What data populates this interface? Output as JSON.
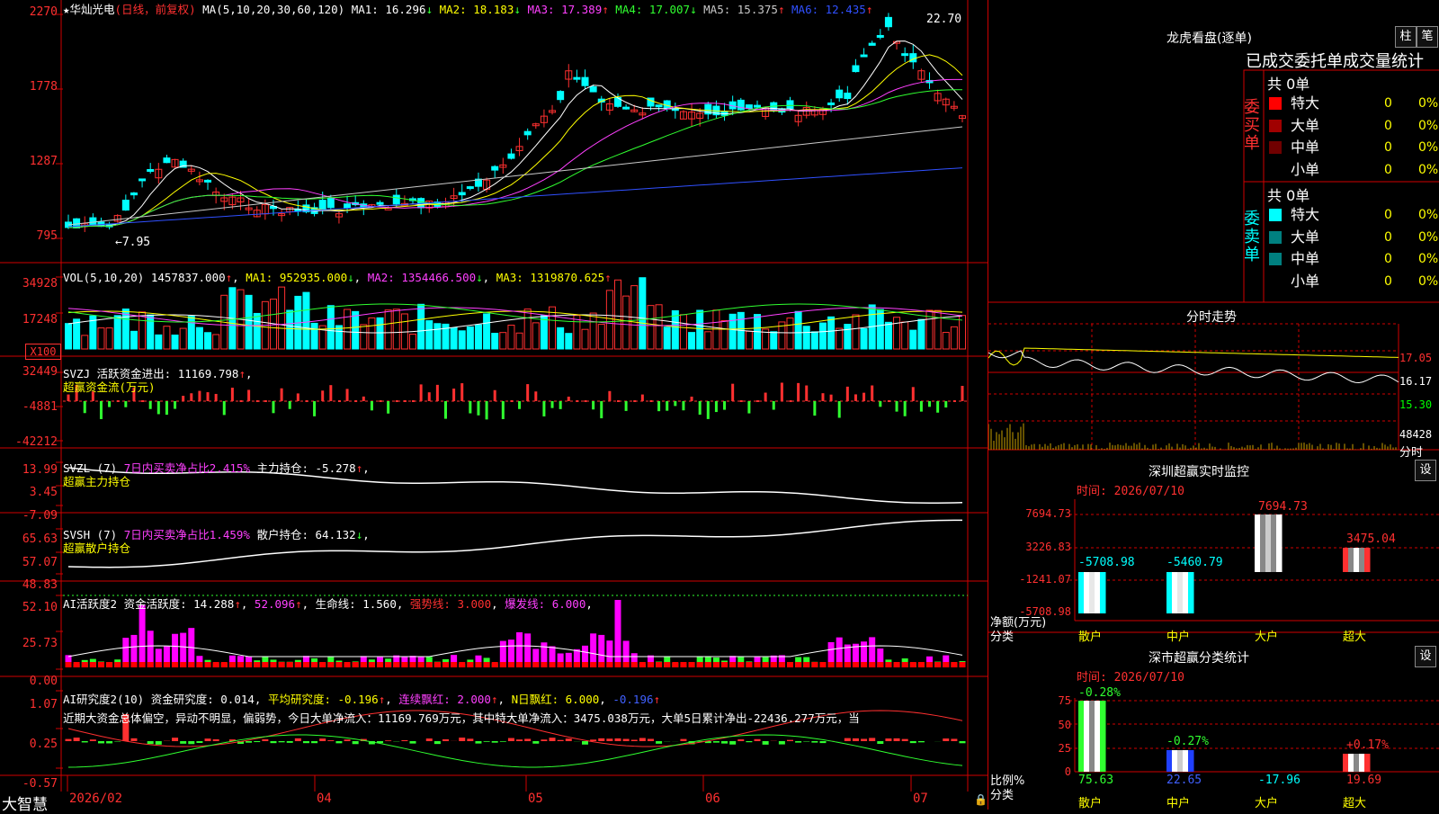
{
  "stock": {
    "name": "华灿光电",
    "mode": "(日线，前复权)",
    "ma_params": "MA(5,10,20,30,60,120)",
    "ma_values": [
      {
        "label": "MA1: 16.296",
        "arrow": "↓",
        "color": "#ffffff"
      },
      {
        "label": "MA2: 18.183",
        "arrow": "↓",
        "color": "#ffff00"
      },
      {
        "label": "MA3: 17.389",
        "arrow": "↑",
        "color": "#ff40ff"
      },
      {
        "label": "MA4: 17.007",
        "arrow": "↓",
        "color": "#30ff30"
      },
      {
        "label": "MA5: 15.375",
        "arrow": "↑",
        "color": "#c8c8c8"
      },
      {
        "label": "MA6: 12.435",
        "arrow": "↑",
        "color": "#3050ff"
      }
    ],
    "high_marker": "22.70",
    "low_marker": "7.95",
    "price_ticks": [
      "2270",
      "1778",
      "1287",
      "795"
    ]
  },
  "volume": {
    "title": "VOL(5,10,20)",
    "value": "1457837.000",
    "ma1": "MA1: 952935.000",
    "ma2": "MA2: 1354466.500",
    "ma3": "MA3: 1319870.625",
    "ticks": [
      "34928",
      "17248"
    ],
    "unit": "X100"
  },
  "svzj": {
    "title": "SVZJ",
    "label": "活跃资金进出: 11169.798",
    "subtitle": "超赢资金流(万元)",
    "ticks": [
      "32449",
      "-4881",
      "-42212"
    ]
  },
  "svzl": {
    "title": "SVZL (7)",
    "label1": "7日内买卖净占比2.415%",
    "label2": "主力持仓: -5.278",
    "subtitle": "超赢主力持仓",
    "ticks": [
      "13.99",
      "3.45",
      "-7.09"
    ]
  },
  "svsh": {
    "title": "SVSH (7)",
    "label1": "7日内买卖净占比1.459%",
    "label2": "散户持仓: 64.132",
    "subtitle": "超赢散户持仓",
    "ticks": [
      "65.63",
      "57.07",
      "48.83"
    ]
  },
  "ai_active": {
    "title": "AI活跃度2",
    "label1": "资金活跃度: 14.288",
    "label2": "52.096",
    "label3": "生命线: 1.560",
    "label4": "强势线: 3.000",
    "label5": "爆发线: 6.000",
    "ticks": [
      "52.10",
      "25.73",
      "0.00"
    ]
  },
  "ai_research": {
    "title": "AI研究度2(10)",
    "label1": "资金研究度: 0.014",
    "label2": "平均研究度: -0.196",
    "label3": "连续飘红: 2.000",
    "label4": "N日飘红: 6.000",
    "label5": "-0.196",
    "summary": "近期大资金总体偏空，异动不明显，偏弱势，今日大单净流入：11169.769万元，其中特大单净流入：3475.038万元，大单5日累计净出-22436.277万元，当",
    "ticks": [
      "1.07",
      "0.25",
      "-0.57"
    ]
  },
  "xaxis": {
    "brand": "大智慧",
    "labels": [
      "2026/02",
      "04",
      "05",
      "06",
      "07"
    ]
  },
  "dragon": {
    "title": "龙虎看盘(逐单)",
    "btn_bar": "柱",
    "btn_pen": "笔",
    "header": "已成交委托单成交量统计",
    "buy_label": "委买单",
    "sell_label": "委卖单",
    "buy_total": "共 0单",
    "sell_total": "共 0单",
    "buy_rows": [
      {
        "label": "特大",
        "count": "0",
        "pct": "0%",
        "color": "#ff0000"
      },
      {
        "label": "大单",
        "count": "0",
        "pct": "0%",
        "color": "#a00000"
      },
      {
        "label": "中单",
        "count": "0",
        "pct": "0%",
        "color": "#700000"
      },
      {
        "label": "小单",
        "count": "0",
        "pct": "0%",
        "color": ""
      }
    ],
    "sell_rows": [
      {
        "label": "特大",
        "count": "0",
        "pct": "0%",
        "color": "#00ffff"
      },
      {
        "label": "大单",
        "count": "0",
        "pct": "0%",
        "color": "#008080"
      },
      {
        "label": "中单",
        "count": "0",
        "pct": "0%",
        "color": "#008080"
      },
      {
        "label": "小单",
        "count": "0",
        "pct": "0%",
        "color": ""
      }
    ]
  },
  "intraday": {
    "title": "分时走势",
    "ticks": [
      "17.05",
      "16.17",
      "15.30",
      "48428"
    ],
    "unit": "分时"
  },
  "sz_monitor": {
    "title": "深圳超赢实时监控",
    "btn": "设",
    "time": "时间: 2026/07/10",
    "ticks": [
      "7694.73",
      "3226.83",
      "-1241.07",
      "-5708.98"
    ],
    "y_unit": "净额(万元)",
    "x_unit": "分类",
    "categories": [
      "散户",
      "中户",
      "大户",
      "超大"
    ],
    "values": [
      "-5708.98",
      "-5460.79",
      "7694.73",
      "3475.04"
    ]
  },
  "sz_class": {
    "title": "深市超赢分类统计",
    "btn": "设",
    "time": "时间: 2026/07/10",
    "ticks": [
      "75",
      "50",
      "25",
      "0"
    ],
    "y_unit": "比例%",
    "x_unit": "分类",
    "categories": [
      "散户",
      "中户",
      "大户",
      "超大"
    ],
    "top_labels": [
      "-0.28%",
      "-0.27%",
      "",
      "+0.17%"
    ],
    "values": [
      "75.63",
      "22.65",
      "-17.96",
      "19.69"
    ]
  }
}
